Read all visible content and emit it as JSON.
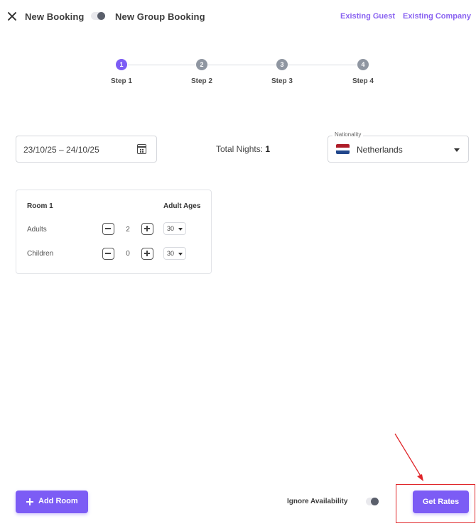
{
  "header": {
    "new_booking": "New Booking",
    "new_group_booking": "New Group Booking",
    "existing_guest": "Existing Guest",
    "existing_company": "Existing Company"
  },
  "stepper": {
    "steps": [
      {
        "number": "1",
        "label": "Step 1",
        "active": true
      },
      {
        "number": "2",
        "label": "Step 2",
        "active": false
      },
      {
        "number": "3",
        "label": "Step 3",
        "active": false
      },
      {
        "number": "4",
        "label": "Step 4",
        "active": false
      }
    ]
  },
  "dates": {
    "value": "23/10/25 – 24/10/25"
  },
  "nights": {
    "label": "Total Nights:",
    "value": "1"
  },
  "nationality": {
    "legend": "Nationality",
    "value": "Netherlands"
  },
  "room": {
    "title": "Room 1",
    "ages_header": "Adult Ages",
    "adults": {
      "label": "Adults",
      "count": "2",
      "age": "30"
    },
    "children": {
      "label": "Children",
      "count": "0",
      "age": "30"
    }
  },
  "footer": {
    "add_room": "Add Room",
    "ignore_availability": "Ignore Availability",
    "get_rates": "Get Rates"
  },
  "colors": {
    "accent": "#7c5cf5",
    "link": "#8a63f1",
    "annotation": "#e0262a"
  },
  "icons": [
    "close-icon",
    "calendar-icon",
    "netherlands-flag-icon",
    "plus-icon",
    "minus-icon",
    "chevron-down-icon"
  ]
}
